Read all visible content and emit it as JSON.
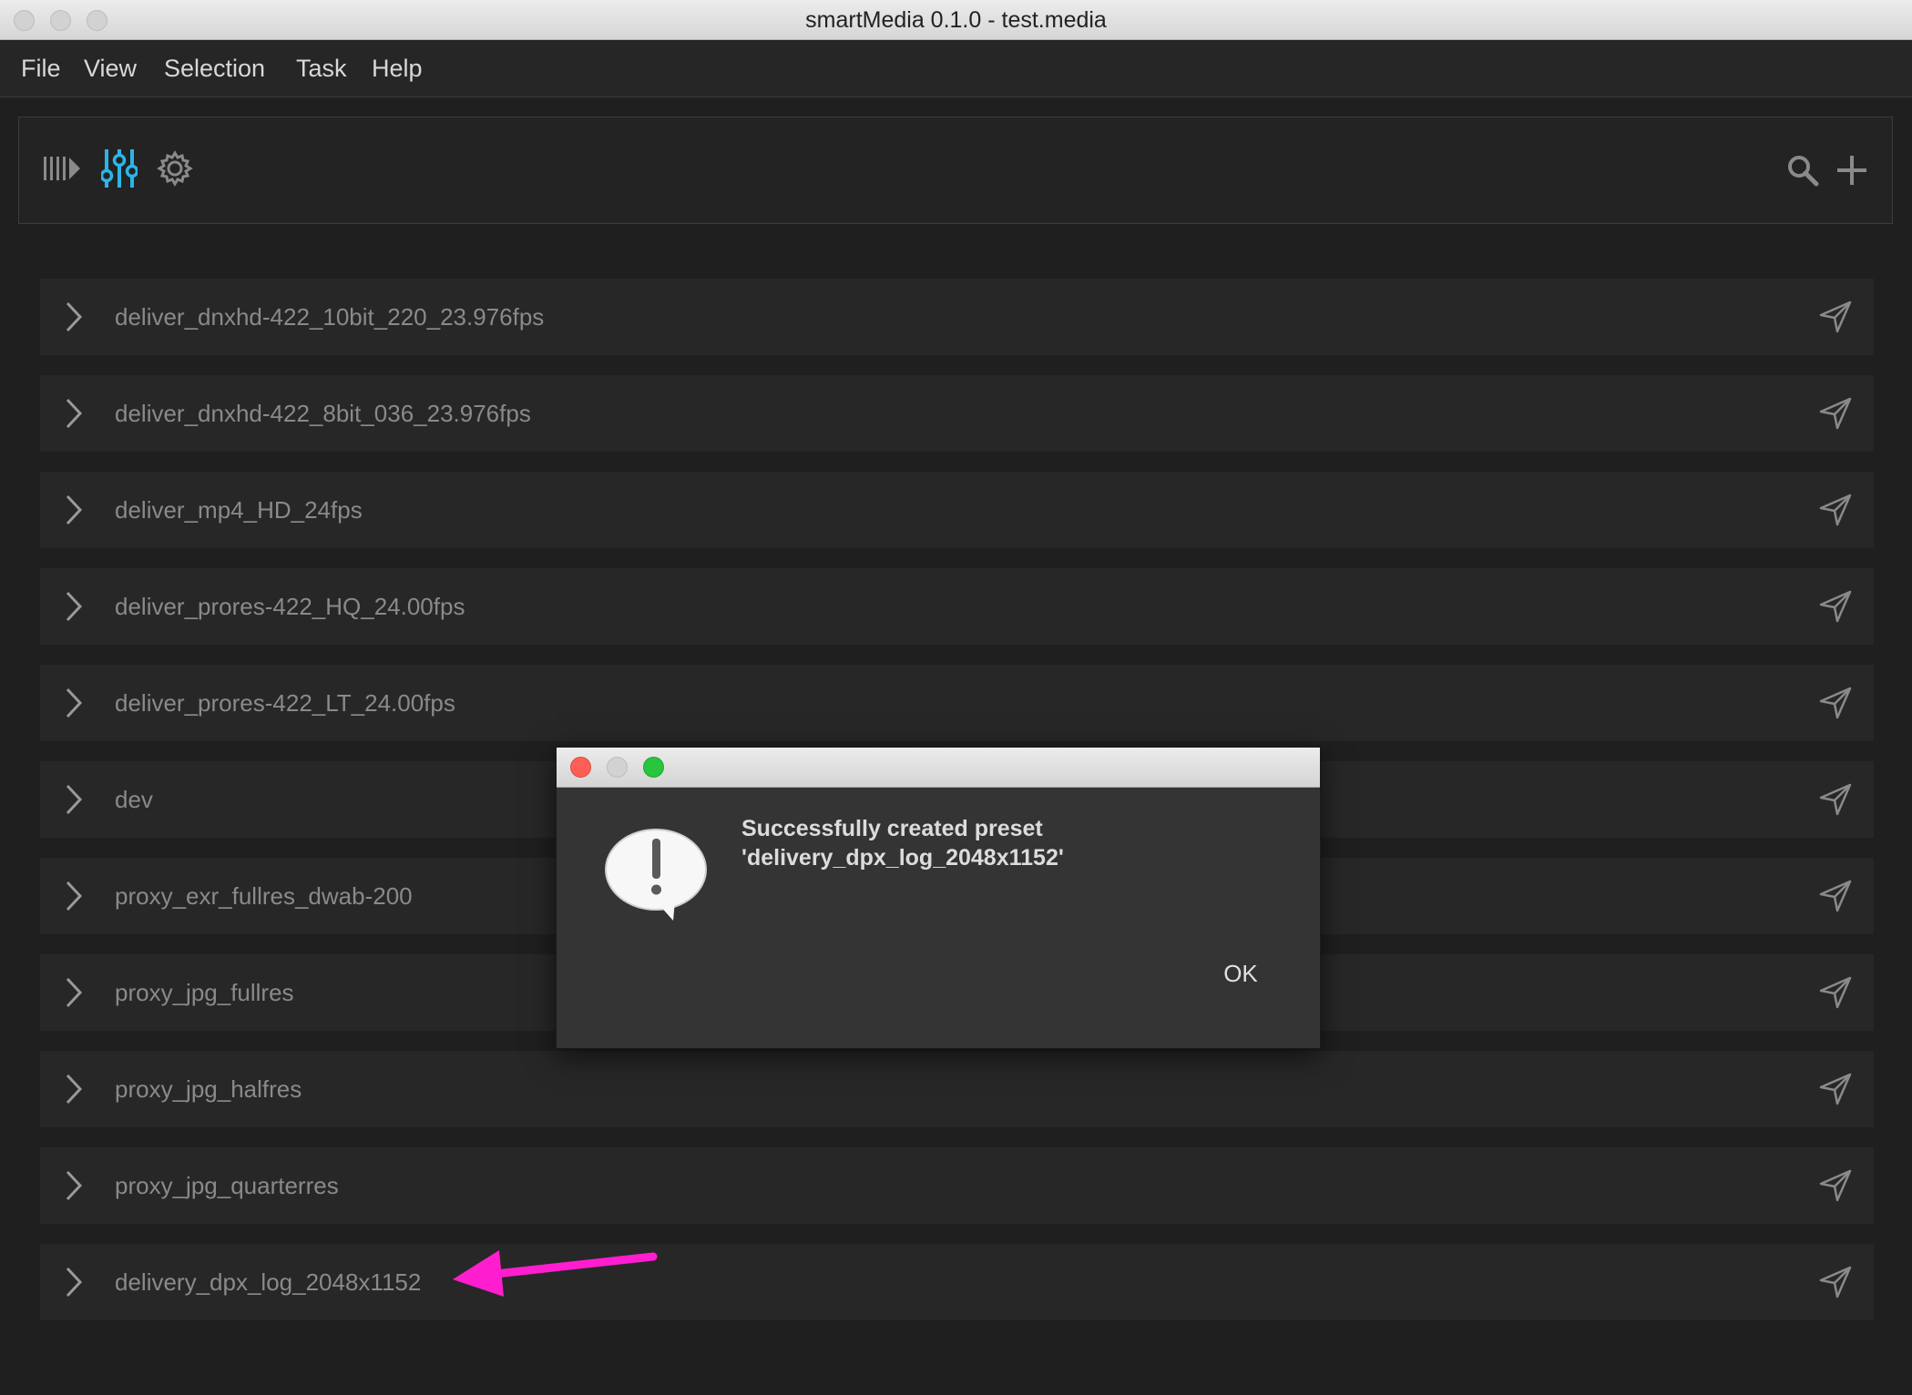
{
  "window": {
    "title": "smartMedia 0.1.0 - test.media"
  },
  "menu": [
    "File",
    "View",
    "Selection",
    "Task",
    "Help"
  ],
  "toolbar": {
    "left_icons": [
      "queue-play-icon",
      "sliders-icon",
      "gear-icon"
    ],
    "right_icons": [
      "search-icon",
      "plus-icon"
    ],
    "accent_color": "#2ab6e8"
  },
  "presets": [
    "deliver_dnxhd-422_10bit_220_23.976fps",
    "deliver_dnxhd-422_8bit_036_23.976fps",
    "deliver_mp4_HD_24fps",
    "deliver_prores-422_HQ_24.00fps",
    "deliver_prores-422_LT_24.00fps",
    "dev",
    "proxy_exr_fullres_dwab-200",
    "proxy_jpg_fullres",
    "proxy_jpg_halfres",
    "proxy_jpg_quarterres",
    "delivery_dpx_log_2048x1152"
  ],
  "dialog": {
    "message_line1": "Successfully created preset",
    "message_line2": "'delivery_dpx_log_2048x1152'",
    "ok_label": "OK"
  },
  "annotation": {
    "arrow_color": "#ff1ecf"
  }
}
